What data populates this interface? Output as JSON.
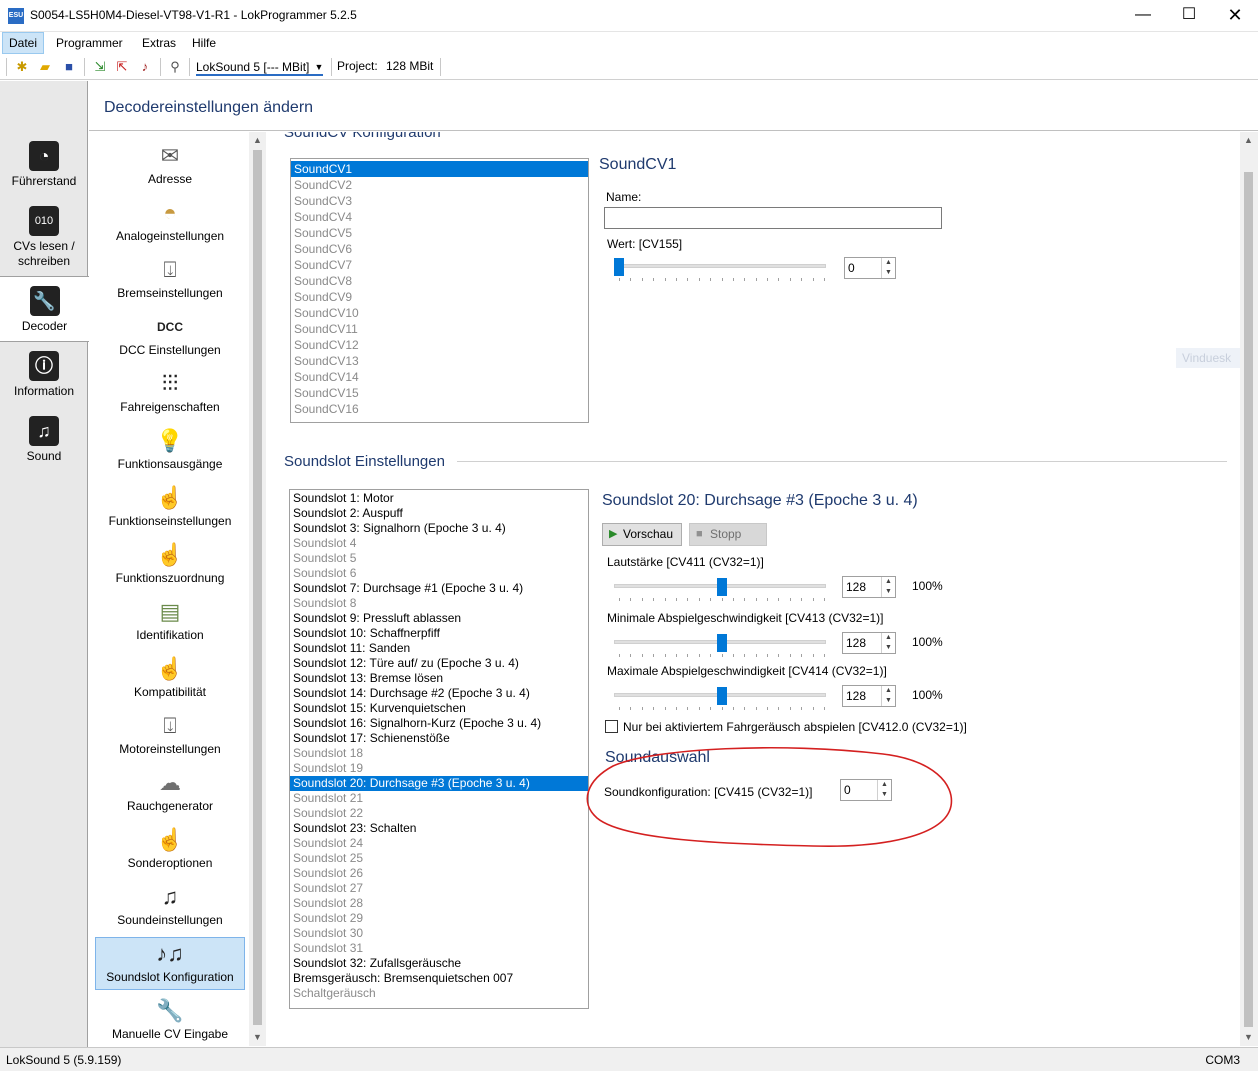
{
  "window": {
    "title": "S0054-LS5H0M4-Diesel-VT98-V1-R1 - LokProgrammer 5.2.5",
    "app_icon_text": "ESU",
    "minimize": "—",
    "maximize": "☐",
    "close": "✕"
  },
  "menu": {
    "items": [
      "Datei",
      "Programmer",
      "Extras",
      "Hilfe"
    ]
  },
  "toolbar": {
    "decoder": "LokSound 5 [--- MBit]",
    "project_label": "Project:",
    "project_value": "128 MBit"
  },
  "leftnav": {
    "items": [
      "Führerstand",
      "CVs lesen / schreiben",
      "Decoder",
      "Information",
      "Sound"
    ]
  },
  "header": {
    "title": "Decodereinstellungen ändern"
  },
  "categories": [
    "Adresse",
    "Analogeinstellungen",
    "Bremseinstellungen",
    "DCC Einstellungen",
    "Fahreigenschaften",
    "Funktionsausgänge",
    "Funktionseinstellungen",
    "Funktionszuordnung",
    "Identifikation",
    "Kompatibilität",
    "Motoreinstellungen",
    "Rauchgenerator",
    "Sonderoptionen",
    "Soundeinstellungen",
    "Soundslot Konfiguration",
    "Manuelle CV Eingabe"
  ],
  "soundcv": {
    "section_title": "SoundCV Konfiguration",
    "items": [
      "SoundCV1",
      "SoundCV2",
      "SoundCV3",
      "SoundCV4",
      "SoundCV5",
      "SoundCV6",
      "SoundCV7",
      "SoundCV8",
      "SoundCV9",
      "SoundCV10",
      "SoundCV11",
      "SoundCV12",
      "SoundCV13",
      "SoundCV14",
      "SoundCV15",
      "SoundCV16"
    ],
    "selected_title": "SoundCV1",
    "name_label": "Name:",
    "name_value": "",
    "wert_label": "Wert: [CV155]",
    "wert_value": "0",
    "wert_fraction": 0
  },
  "soundslot": {
    "section_title": "Soundslot Einstellungen",
    "items": [
      "Soundslot 1: Motor",
      "Soundslot 2: Auspuff",
      "Soundslot 3: Signalhorn (Epoche 3 u. 4)",
      "Soundslot 4",
      "Soundslot 5",
      "Soundslot 6",
      "Soundslot 7: Durchsage #1  (Epoche 3 u. 4)",
      "Soundslot 8",
      "Soundslot 9: Pressluft ablassen",
      "Soundslot 10: Schaffnerpfiff",
      "Soundslot 11: Sanden",
      "Soundslot 12: Türe auf/ zu (Epoche 3 u. 4)",
      "Soundslot 13: Bremse lösen",
      "Soundslot 14: Durchsage #2 (Epoche 3 u. 4)",
      "Soundslot 15: Kurvenquietschen",
      "Soundslot 16: Signalhorn-Kurz (Epoche 3 u. 4)",
      "Soundslot 17: Schienenstöße",
      "Soundslot 18",
      "Soundslot 19",
      "Soundslot 20: Durchsage #3 (Epoche 3 u. 4)",
      "Soundslot 21",
      "Soundslot 22",
      "Soundslot 23: Schalten",
      "Soundslot 24",
      "Soundslot 25",
      "Soundslot 26",
      "Soundslot 27",
      "Soundslot 28",
      "Soundslot 29",
      "Soundslot 30",
      "Soundslot 31",
      "Soundslot 32: Zufallsgeräusche",
      "Bremsgeräusch: Bremsenquietschen 007",
      "Schaltgeräusch"
    ],
    "selected_index": 19,
    "selected_title": "Soundslot 20: Durchsage #3 (Epoche 3 u. 4)",
    "preview_label": "Vorschau",
    "stop_label": "Stopp",
    "sliders": [
      {
        "label": "Lautstärke [CV411 (CV32=1)]",
        "value": "128",
        "percent": "100%",
        "fraction": 0.5
      },
      {
        "label": "Minimale Abspielgeschwindigkeit [CV413 (CV32=1)]",
        "value": "128",
        "percent": "100%",
        "fraction": 0.5
      },
      {
        "label": "Maximale Abspielgeschwindigkeit [CV414 (CV32=1)]",
        "value": "128",
        "percent": "100%",
        "fraction": 0.5
      }
    ],
    "checkbox_label": "Nur bei aktiviertem Fahrgeräusch abspielen [CV412.0 (CV32=1)]",
    "checkbox_checked": false
  },
  "soundauswahl": {
    "title": "Soundauswahl",
    "label": "Soundkonfiguration: [CV415 (CV32=1)]",
    "value": "0"
  },
  "watermark": "Vinduesk",
  "statusbar": {
    "left": "LokSound 5 (5.9.159)",
    "right": "COM3"
  },
  "colors": {
    "accent": "#0078d7",
    "heading": "#1f3a6e",
    "annotation": "#d42020"
  }
}
